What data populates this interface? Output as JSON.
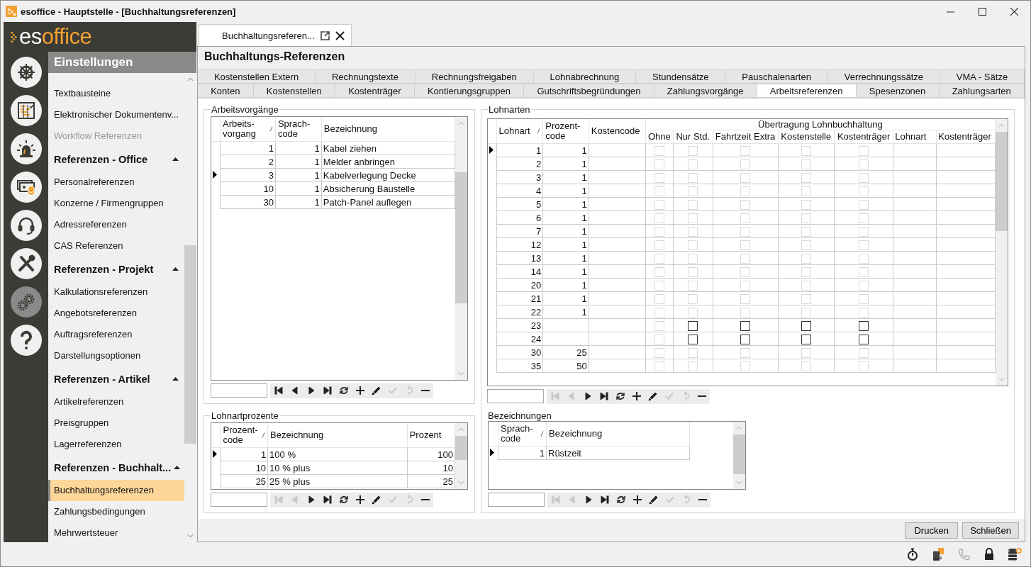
{
  "window": {
    "title": "esoffice - Hauptstelle - [Buchhaltungsreferenzen]"
  },
  "logo": {
    "part_1": "es",
    "part_2": "office"
  },
  "rail": [
    {
      "kind": "helm",
      "selected": false
    },
    {
      "kind": "board",
      "selected": false
    },
    {
      "kind": "siren",
      "selected": false
    },
    {
      "kind": "money",
      "selected": false
    },
    {
      "kind": "headset",
      "selected": false
    },
    {
      "kind": "tools",
      "selected": false
    },
    {
      "kind": "gears",
      "selected": true
    },
    {
      "kind": "help",
      "selected": false
    }
  ],
  "sidebar": {
    "title": "Einstellungen",
    "items": [
      {
        "kind": "item",
        "label": "Textbausteine",
        "selected": false,
        "disabled": false
      },
      {
        "kind": "item",
        "label": "Elektronischer Dokumentenv...",
        "selected": false,
        "disabled": false
      },
      {
        "kind": "item",
        "label": "Workflow Referenzen",
        "selected": false,
        "disabled": true
      },
      {
        "kind": "header",
        "label": "Referenzen - Office",
        "expanded": true
      },
      {
        "kind": "item",
        "label": "Personalreferenzen",
        "selected": false,
        "disabled": false
      },
      {
        "kind": "item",
        "label": "Konzerne / Firmengruppen",
        "selected": false,
        "disabled": false
      },
      {
        "kind": "item",
        "label": "Adressreferenzen",
        "selected": false,
        "disabled": false
      },
      {
        "kind": "item",
        "label": "CAS Referenzen",
        "selected": false,
        "disabled": false
      },
      {
        "kind": "header",
        "label": "Referenzen - Projekt",
        "expanded": true
      },
      {
        "kind": "item",
        "label": "Kalkulationsreferenzen",
        "selected": false,
        "disabled": false
      },
      {
        "kind": "item",
        "label": "Angebotsreferenzen",
        "selected": false,
        "disabled": false
      },
      {
        "kind": "item",
        "label": "Auftragsreferenzen",
        "selected": false,
        "disabled": false
      },
      {
        "kind": "item",
        "label": "Darstellungsoptionen",
        "selected": false,
        "disabled": false
      },
      {
        "kind": "header",
        "label": "Referenzen - Artikel",
        "expanded": true
      },
      {
        "kind": "item",
        "label": "Artikelreferenzen",
        "selected": false,
        "disabled": false
      },
      {
        "kind": "item",
        "label": "Preisgruppen",
        "selected": false,
        "disabled": false
      },
      {
        "kind": "item",
        "label": "Lagerreferenzen",
        "selected": false,
        "disabled": false
      },
      {
        "kind": "header",
        "label": "Referenzen - Buchhalt...",
        "expanded": true
      },
      {
        "kind": "item",
        "label": "Buchhaltungsreferenzen",
        "selected": true,
        "disabled": false
      },
      {
        "kind": "item",
        "label": "Zahlungsbedingungen",
        "selected": false,
        "disabled": false
      },
      {
        "kind": "item",
        "label": "Mehrwertsteuer",
        "selected": false,
        "disabled": false
      }
    ]
  },
  "document_tab": {
    "label": "Buchhaltungsreferen..."
  },
  "page_title": "Buchhaltungs-Referenzen",
  "tab_rows": [
    {
      "tabs": [
        {
          "label": "Kostenstellen Extern",
          "selected": false
        },
        {
          "label": "Rechnungstexte",
          "selected": false
        },
        {
          "label": "Rechnungsfreigaben",
          "selected": false
        },
        {
          "label": "Lohnabrechnung",
          "selected": false
        },
        {
          "label": "Stundensätze",
          "selected": false
        },
        {
          "label": "Pauschalenarten",
          "selected": false
        },
        {
          "label": "Verrechnungssätze",
          "selected": false
        },
        {
          "label": "VMA - Sätze",
          "selected": false
        }
      ]
    },
    {
      "tabs": [
        {
          "label": "Konten",
          "selected": false
        },
        {
          "label": "Kostenstellen",
          "selected": false
        },
        {
          "label": "Kostenträger",
          "selected": false
        },
        {
          "label": "Kontierungsgruppen",
          "selected": false
        },
        {
          "label": "Gutschriftsbegründungen",
          "selected": false
        },
        {
          "label": "Zahlungsvorgänge",
          "selected": false
        },
        {
          "label": "Arbeitsreferenzen",
          "selected": true
        },
        {
          "label": "Spesenzonen",
          "selected": false
        },
        {
          "label": "Zahlungsarten",
          "selected": false
        }
      ]
    }
  ],
  "arbeitsvorgaenge": {
    "title": "Arbeitsvorgänge",
    "columns": [
      {
        "label": "Arbeits-\nvorgang",
        "kind": "number",
        "sorted": true
      },
      {
        "label": "Sprach-\ncode",
        "kind": "number",
        "sorted": false
      },
      {
        "label": "Bezeichnung",
        "kind": "text",
        "sorted": false
      }
    ],
    "rows": [
      {
        "selected": false,
        "cells": [
          "1",
          "1",
          "Kabel ziehen"
        ]
      },
      {
        "selected": false,
        "cells": [
          "2",
          "1",
          "Melder anbringen"
        ]
      },
      {
        "selected": true,
        "cells": [
          "3",
          "1",
          "Kabelverlegung Decke"
        ]
      },
      {
        "selected": false,
        "cells": [
          "10",
          "1",
          "Absicherung Baustelle"
        ]
      },
      {
        "selected": false,
        "cells": [
          "30",
          "1",
          "Patch-Panel auflegen"
        ]
      }
    ],
    "navigator": [
      {
        "kind": "first",
        "disabled": false
      },
      {
        "kind": "prev",
        "disabled": false
      },
      {
        "kind": "next",
        "disabled": false
      },
      {
        "kind": "last",
        "disabled": false
      },
      {
        "kind": "refresh",
        "disabled": false
      },
      {
        "kind": "add",
        "disabled": false
      },
      {
        "kind": "edit",
        "disabled": false
      },
      {
        "kind": "post",
        "disabled": true
      },
      {
        "kind": "cancel",
        "disabled": true
      },
      {
        "kind": "delete",
        "disabled": false
      }
    ]
  },
  "lohnarten": {
    "title": "Lohnarten",
    "columns": [
      {
        "label": "Lohnart",
        "sorted": true
      },
      {
        "label": "Prozent-\ncode",
        "sorted": false
      },
      {
        "label": "Kostencode",
        "sorted": false
      }
    ],
    "group_heading": "Übertragung Lohnbuchhaltung",
    "sub_columns": [
      "Ohne",
      "Nur Std.",
      "Fahrtzeit Extra",
      "Kostenstelle",
      "Kostenträger",
      "Lohnart",
      "Kostenträger"
    ],
    "rows": [
      {
        "selected": true,
        "lohnart": "1",
        "prozentcode": "1",
        "checks": [
          {
            "checked": false,
            "disabled": true
          },
          {
            "checked": false,
            "disabled": true
          },
          {
            "checked": false,
            "disabled": true
          },
          {
            "checked": false,
            "disabled": true
          },
          {
            "checked": false,
            "disabled": true
          }
        ]
      },
      {
        "selected": false,
        "lohnart": "2",
        "prozentcode": "1",
        "checks": [
          {
            "checked": false,
            "disabled": true
          },
          {
            "checked": false,
            "disabled": true
          },
          {
            "checked": false,
            "disabled": true
          },
          {
            "checked": false,
            "disabled": true
          },
          {
            "checked": false,
            "disabled": true
          }
        ]
      },
      {
        "selected": false,
        "lohnart": "3",
        "prozentcode": "1",
        "checks": [
          {
            "checked": false,
            "disabled": true
          },
          {
            "checked": false,
            "disabled": true
          },
          {
            "checked": false,
            "disabled": true
          },
          {
            "checked": false,
            "disabled": true
          },
          {
            "checked": false,
            "disabled": true
          }
        ]
      },
      {
        "selected": false,
        "lohnart": "4",
        "prozentcode": "1",
        "checks": [
          {
            "checked": false,
            "disabled": true
          },
          {
            "checked": false,
            "disabled": true
          },
          {
            "checked": false,
            "disabled": true
          },
          {
            "checked": false,
            "disabled": true
          },
          {
            "checked": false,
            "disabled": true
          }
        ]
      },
      {
        "selected": false,
        "lohnart": "5",
        "prozentcode": "1",
        "checks": [
          {
            "checked": false,
            "disabled": true
          },
          {
            "checked": false,
            "disabled": true
          },
          {
            "checked": false,
            "disabled": true
          },
          {
            "checked": false,
            "disabled": true
          },
          {
            "checked": false,
            "disabled": true
          }
        ]
      },
      {
        "selected": false,
        "lohnart": "6",
        "prozentcode": "1",
        "checks": [
          {
            "checked": false,
            "disabled": true
          },
          {
            "checked": false,
            "disabled": true
          },
          {
            "checked": false,
            "disabled": true
          },
          {
            "checked": false,
            "disabled": true
          },
          {
            "checked": false,
            "disabled": true
          }
        ]
      },
      {
        "selected": false,
        "lohnart": "7",
        "prozentcode": "1",
        "checks": [
          {
            "checked": false,
            "disabled": true
          },
          {
            "checked": false,
            "disabled": true
          },
          {
            "checked": false,
            "disabled": true
          },
          {
            "checked": false,
            "disabled": true
          },
          {
            "checked": false,
            "disabled": true
          }
        ]
      },
      {
        "selected": false,
        "lohnart": "12",
        "prozentcode": "1",
        "checks": [
          {
            "checked": false,
            "disabled": true
          },
          {
            "checked": false,
            "disabled": true
          },
          {
            "checked": false,
            "disabled": true
          },
          {
            "checked": false,
            "disabled": true
          },
          {
            "checked": false,
            "disabled": true
          }
        ]
      },
      {
        "selected": false,
        "lohnart": "13",
        "prozentcode": "1",
        "checks": [
          {
            "checked": false,
            "disabled": true
          },
          {
            "checked": false,
            "disabled": true
          },
          {
            "checked": false,
            "disabled": true
          },
          {
            "checked": false,
            "disabled": true
          },
          {
            "checked": false,
            "disabled": true
          }
        ]
      },
      {
        "selected": false,
        "lohnart": "14",
        "prozentcode": "1",
        "checks": [
          {
            "checked": false,
            "disabled": true
          },
          {
            "checked": false,
            "disabled": true
          },
          {
            "checked": false,
            "disabled": true
          },
          {
            "checked": false,
            "disabled": true
          },
          {
            "checked": false,
            "disabled": true
          }
        ]
      },
      {
        "selected": false,
        "lohnart": "20",
        "prozentcode": "1",
        "checks": [
          {
            "checked": false,
            "disabled": true
          },
          {
            "checked": false,
            "disabled": true
          },
          {
            "checked": false,
            "disabled": true
          },
          {
            "checked": false,
            "disabled": true
          },
          {
            "checked": false,
            "disabled": true
          }
        ]
      },
      {
        "selected": false,
        "lohnart": "21",
        "prozentcode": "1",
        "checks": [
          {
            "checked": false,
            "disabled": true
          },
          {
            "checked": false,
            "disabled": true
          },
          {
            "checked": false,
            "disabled": true
          },
          {
            "checked": false,
            "disabled": true
          },
          {
            "checked": false,
            "disabled": true
          }
        ]
      },
      {
        "selected": false,
        "lohnart": "22",
        "prozentcode": "1",
        "checks": [
          {
            "checked": false,
            "disabled": true
          },
          {
            "checked": false,
            "disabled": true
          },
          {
            "checked": false,
            "disabled": true
          },
          {
            "checked": false,
            "disabled": true
          },
          {
            "checked": false,
            "disabled": true
          }
        ]
      },
      {
        "selected": false,
        "lohnart": "23",
        "checks": [
          {
            "checked": false,
            "disabled": true
          },
          {
            "checked": false,
            "disabled": false
          },
          {
            "checked": false,
            "disabled": false
          },
          {
            "checked": false,
            "disabled": false
          },
          {
            "checked": false,
            "disabled": false
          }
        ]
      },
      {
        "selected": false,
        "lohnart": "24",
        "checks": [
          {
            "checked": false,
            "disabled": true
          },
          {
            "checked": false,
            "disabled": false
          },
          {
            "checked": false,
            "disabled": false
          },
          {
            "checked": false,
            "disabled": false
          },
          {
            "checked": false,
            "disabled": false
          }
        ]
      },
      {
        "selected": false,
        "lohnart": "30",
        "prozentcode": "25",
        "checks": [
          {
            "checked": false,
            "disabled": true
          },
          {
            "checked": false,
            "disabled": true
          },
          {
            "checked": false,
            "disabled": true
          },
          {
            "checked": false,
            "disabled": true
          },
          {
            "checked": false,
            "disabled": true
          }
        ]
      },
      {
        "selected": false,
        "lohnart": "35",
        "prozentcode": "50",
        "checks": [
          {
            "checked": false,
            "disabled": true
          },
          {
            "checked": false,
            "disabled": true
          },
          {
            "checked": false,
            "disabled": true
          },
          {
            "checked": false,
            "disabled": true
          },
          {
            "checked": false,
            "disabled": true
          }
        ]
      }
    ],
    "navigator": [
      {
        "kind": "first",
        "disabled": true
      },
      {
        "kind": "prev",
        "disabled": true
      },
      {
        "kind": "next",
        "disabled": false
      },
      {
        "kind": "last",
        "disabled": false
      },
      {
        "kind": "refresh",
        "disabled": false
      },
      {
        "kind": "add",
        "disabled": false
      },
      {
        "kind": "edit",
        "disabled": false
      },
      {
        "kind": "post",
        "disabled": true
      },
      {
        "kind": "cancel",
        "disabled": true
      },
      {
        "kind": "delete",
        "disabled": false
      }
    ]
  },
  "lohnartprozente": {
    "title": "Lohnartprozente",
    "columns": [
      {
        "label": "Prozent-\ncode",
        "kind": "number",
        "sorted": true
      },
      {
        "label": "Bezeichnung",
        "kind": "text",
        "sorted": false
      },
      {
        "label": "Prozent",
        "kind": "number",
        "sorted": false
      }
    ],
    "rows": [
      {
        "selected": true,
        "cells": [
          "1",
          "100 %",
          "100"
        ]
      },
      {
        "selected": false,
        "cells": [
          "10",
          "10 % plus",
          "10"
        ]
      },
      {
        "selected": false,
        "cells": [
          "25",
          "25 % plus",
          "25"
        ]
      }
    ],
    "navigator": [
      {
        "kind": "first",
        "disabled": true
      },
      {
        "kind": "prev",
        "disabled": true
      },
      {
        "kind": "next",
        "disabled": false
      },
      {
        "kind": "last",
        "disabled": false
      },
      {
        "kind": "refresh",
        "disabled": false
      },
      {
        "kind": "add",
        "disabled": false
      },
      {
        "kind": "edit",
        "disabled": false
      },
      {
        "kind": "post",
        "disabled": true
      },
      {
        "kind": "cancel",
        "disabled": true
      },
      {
        "kind": "delete",
        "disabled": false
      }
    ]
  },
  "bezeichnungen": {
    "title": "Bezeichnungen",
    "columns": [
      {
        "label": "Sprach-\ncode",
        "kind": "number",
        "sorted": true
      },
      {
        "label": "Bezeichnung",
        "kind": "text",
        "sorted": false
      }
    ],
    "rows": [
      {
        "selected": true,
        "cells": [
          "1",
          "Rüstzeit"
        ]
      }
    ],
    "navigator": [
      {
        "kind": "first",
        "disabled": true
      },
      {
        "kind": "prev",
        "disabled": true
      },
      {
        "kind": "next",
        "disabled": false
      },
      {
        "kind": "last",
        "disabled": false
      },
      {
        "kind": "refresh",
        "disabled": false
      },
      {
        "kind": "add",
        "disabled": false
      },
      {
        "kind": "edit",
        "disabled": false
      },
      {
        "kind": "post",
        "disabled": true
      },
      {
        "kind": "cancel",
        "disabled": true
      },
      {
        "kind": "delete",
        "disabled": false
      }
    ]
  },
  "buttons": [
    {
      "label": "Drucken"
    },
    {
      "label": "Schließen"
    }
  ]
}
